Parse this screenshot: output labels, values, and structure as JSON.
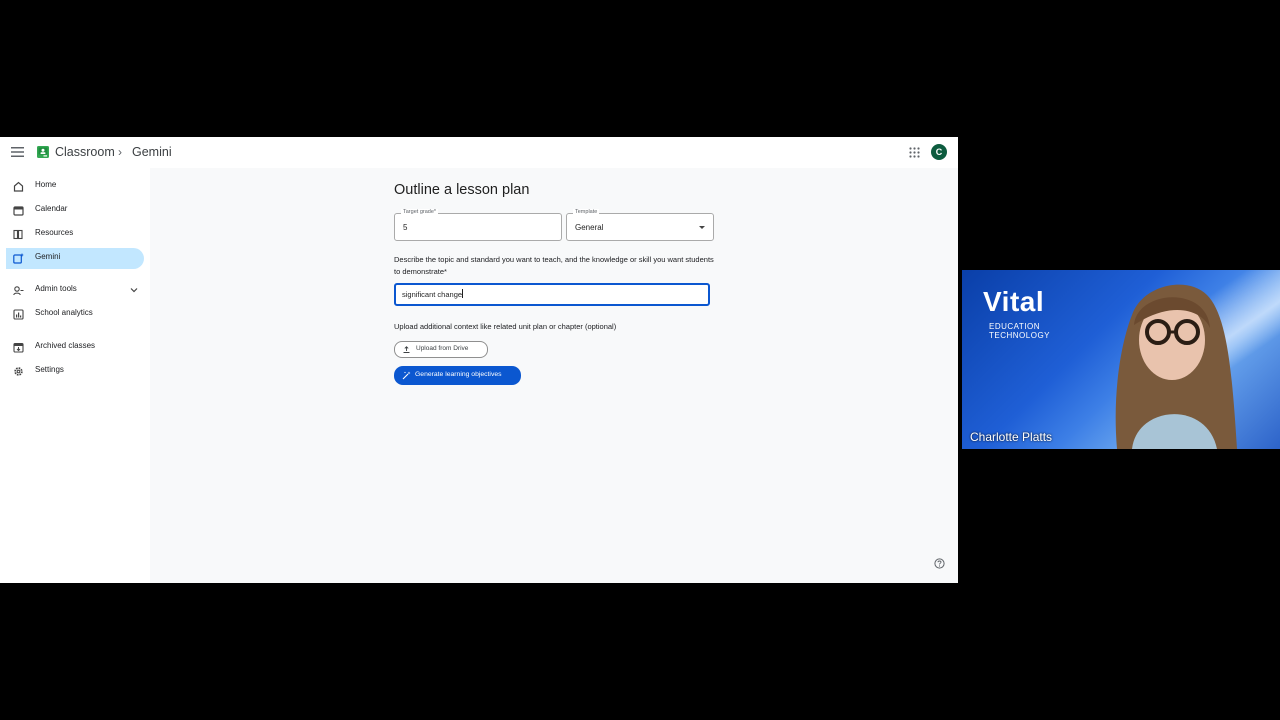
{
  "header": {
    "app_name": "Classroom",
    "breadcrumb_separator": "›",
    "breadcrumb_current": "Gemini",
    "avatar_initial": "C"
  },
  "sidebar": {
    "items": [
      {
        "label": "Home",
        "icon": "home-icon"
      },
      {
        "label": "Calendar",
        "icon": "calendar-icon"
      },
      {
        "label": "Resources",
        "icon": "resources-icon"
      },
      {
        "label": "Gemini",
        "icon": "gemini-icon",
        "active": true
      },
      {
        "label": "Admin tools",
        "icon": "admin-tools-icon",
        "expandable": true
      },
      {
        "label": "School analytics",
        "icon": "analytics-icon"
      },
      {
        "label": "Archived classes",
        "icon": "archive-icon"
      },
      {
        "label": "Settings",
        "icon": "gear-icon"
      }
    ]
  },
  "main": {
    "title": "Outline a lesson plan",
    "target_grade": {
      "label": "Target grade*",
      "value": "5"
    },
    "template": {
      "label": "Template",
      "value": "General"
    },
    "description_label": "Describe the topic and standard you want to teach, and the knowledge or skill you want students to demonstrate*",
    "topic_value": "significant change",
    "upload_context_label": "Upload additional context like related unit plan or chapter (optional)",
    "upload_button": "Upload from Drive",
    "generate_button": "Generate learning objectives"
  },
  "video": {
    "brand_name": "Vital",
    "brand_line1": "EDUCATION",
    "brand_line2": "TECHNOLOGY",
    "participant_name": "Charlotte Platts"
  },
  "colors": {
    "accent": "#0b57d0",
    "active_nav": "#c2e7ff",
    "avatar": "#0d5c3f",
    "classroom_logo": "#34a853"
  }
}
